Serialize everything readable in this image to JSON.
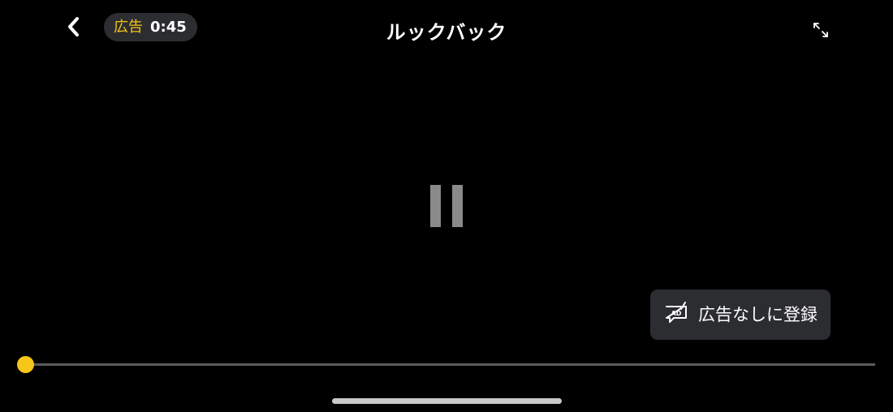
{
  "header": {
    "back_icon": "chevron-left-icon",
    "ad_badge": {
      "label": "広告",
      "countdown": "0:45",
      "label_color": "#f5c518"
    },
    "title": "ルックバック",
    "fullscreen_icon": "expand-arrows-icon"
  },
  "player": {
    "state_icon": "pause-icon",
    "progress_fraction": 0.0,
    "accent_color": "#f5c518"
  },
  "ad_free_button": {
    "icon": "ad-free-chat-icon",
    "label": "広告なしに登録"
  }
}
